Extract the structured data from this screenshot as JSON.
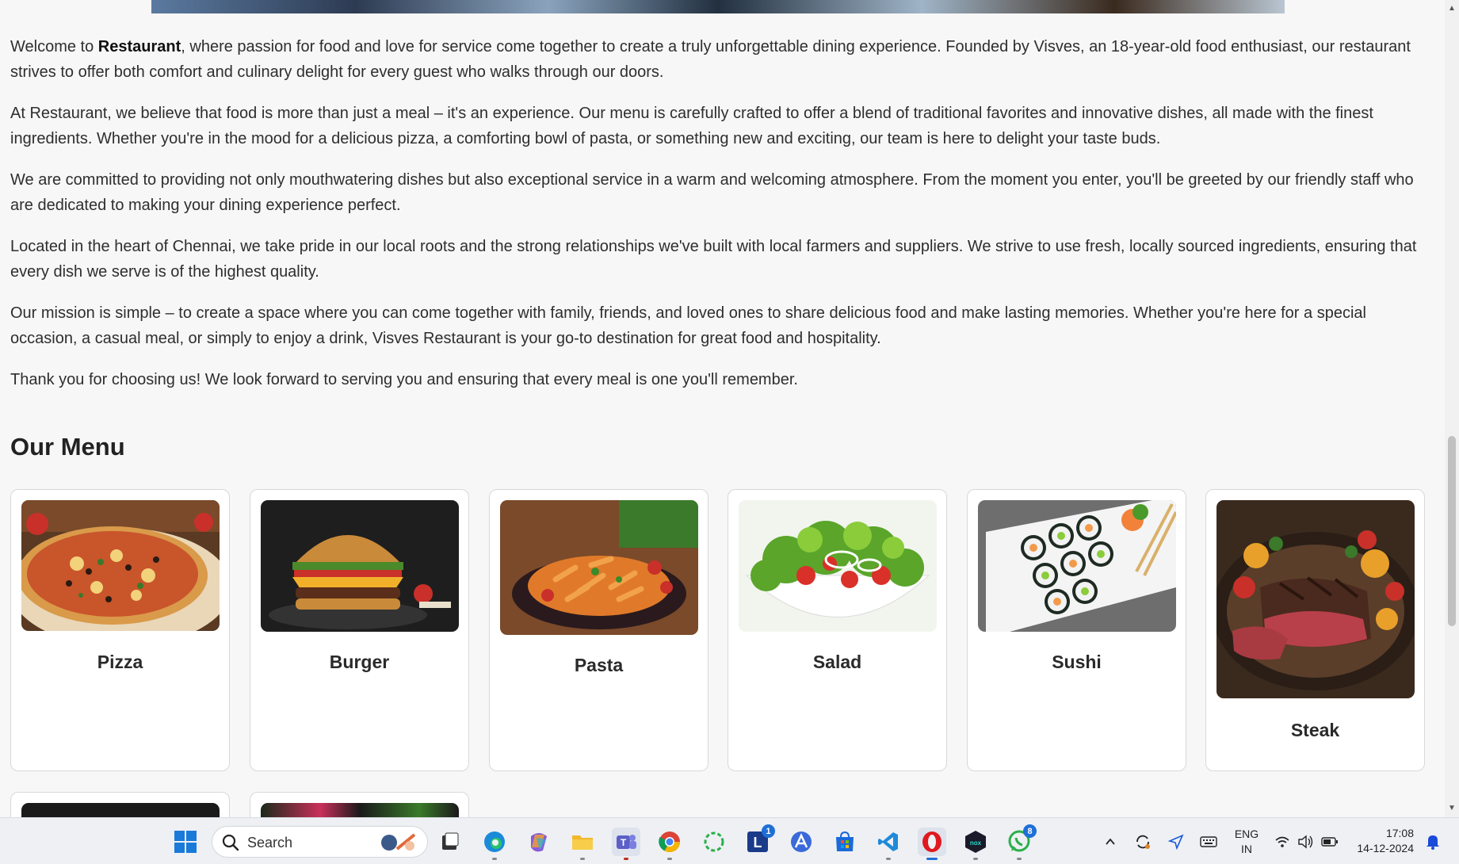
{
  "about": {
    "p1_pre": "Welcome to ",
    "p1_bold": "Restaurant",
    "p1_post": ", where passion for food and love for service come together to create a truly unforgettable dining experience. Founded by Visves, an 18-year-old food enthusiast, our restaurant strives to offer both comfort and culinary delight for every guest who walks through our doors.",
    "p2": "At Restaurant, we believe that food is more than just a meal – it's an experience. Our menu is carefully crafted to offer a blend of traditional favorites and innovative dishes, all made with the finest ingredients. Whether you're in the mood for a delicious pizza, a comforting bowl of pasta, or something new and exciting, our team is here to delight your taste buds.",
    "p3": "We are committed to providing not only mouthwatering dishes but also exceptional service in a warm and welcoming atmosphere. From the moment you enter, you'll be greeted by our friendly staff who are dedicated to making your dining experience perfect.",
    "p4": "Located in the heart of Chennai, we take pride in our local roots and the strong relationships we've built with local farmers and suppliers. We strive to use fresh, locally sourced ingredients, ensuring that every dish we serve is of the highest quality.",
    "p5": "Our mission is simple – to create a space where you can come together with family, friends, and loved ones to share delicious food and make lasting memories. Whether you're here for a special occasion, a casual meal, or simply to enjoy a drink, Visves Restaurant is your go-to destination for great food and hospitality.",
    "p6": "Thank you for choosing us! We look forward to serving you and ensuring that every meal is one you'll remember."
  },
  "menu": {
    "title": "Our Menu",
    "items": [
      {
        "name": "Pizza"
      },
      {
        "name": "Burger"
      },
      {
        "name": "Pasta"
      },
      {
        "name": "Salad"
      },
      {
        "name": "Sushi"
      },
      {
        "name": "Steak"
      }
    ]
  },
  "taskbar": {
    "search_label": "Search",
    "apps": [
      "windows-start",
      "search",
      "task-view",
      "edge",
      "copilot",
      "file-explorer",
      "teams",
      "chrome",
      "loader-app",
      "l-app",
      "affinity-app",
      "store",
      "vscode",
      "opera",
      "nox",
      "whatsapp"
    ],
    "l_app_badge": "1",
    "whatsapp_badge": "8",
    "lang_line1": "ENG",
    "lang_line2": "IN",
    "time": "17:08",
    "date": "14-12-2024"
  },
  "colors": {
    "page_bg": "#f7f7f7",
    "card_bg": "#ffffff",
    "taskbar_bg": "#eef0f4",
    "badge_blue": "#1f6fd6"
  }
}
